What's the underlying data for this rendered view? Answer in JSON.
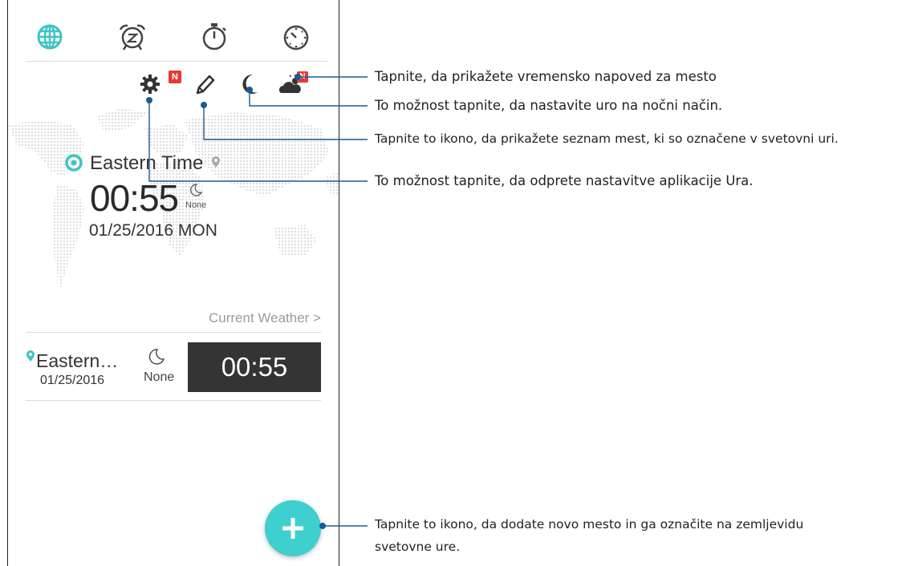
{
  "tabs": {
    "world_clock": "world-clock-icon",
    "alarm": "alarm-clock-icon",
    "stopwatch": "stopwatch-icon",
    "timer": "timer-icon",
    "active_color": "#3fc3c3",
    "inactive_color": "#444444"
  },
  "toolbar": {
    "settings_badge": "N",
    "weather_badge": "N",
    "badge_color": "#e53935"
  },
  "main_clock": {
    "city": "Eastern Time",
    "time": "00:55",
    "night_label": "None",
    "date": "01/25/2016 MON"
  },
  "weather_link": "Current Weather >",
  "city_list": [
    {
      "city": "Eastern…",
      "date": "01/25/2016",
      "night_label": "None",
      "time": "00:55"
    }
  ],
  "fab": {
    "color": "#3fcfce"
  },
  "callouts": {
    "weather": "Tapnite, da prikažete vremensko napoved za mesto",
    "night": "To možnost tapnite, da nastavite uro na nočni način.",
    "edit": "Tapnite to ikono, da prikažete seznam mest, ki so označene v svetovni uri.",
    "settings": "To možnost tapnite, da odprete nastavitve aplikacije Ura.",
    "add_line1": "Tapnite to ikono, da dodate novo mesto in ga označite na zemljevidu",
    "add_line2": "svetovne ure.",
    "line_color": "#1c5a8f"
  }
}
